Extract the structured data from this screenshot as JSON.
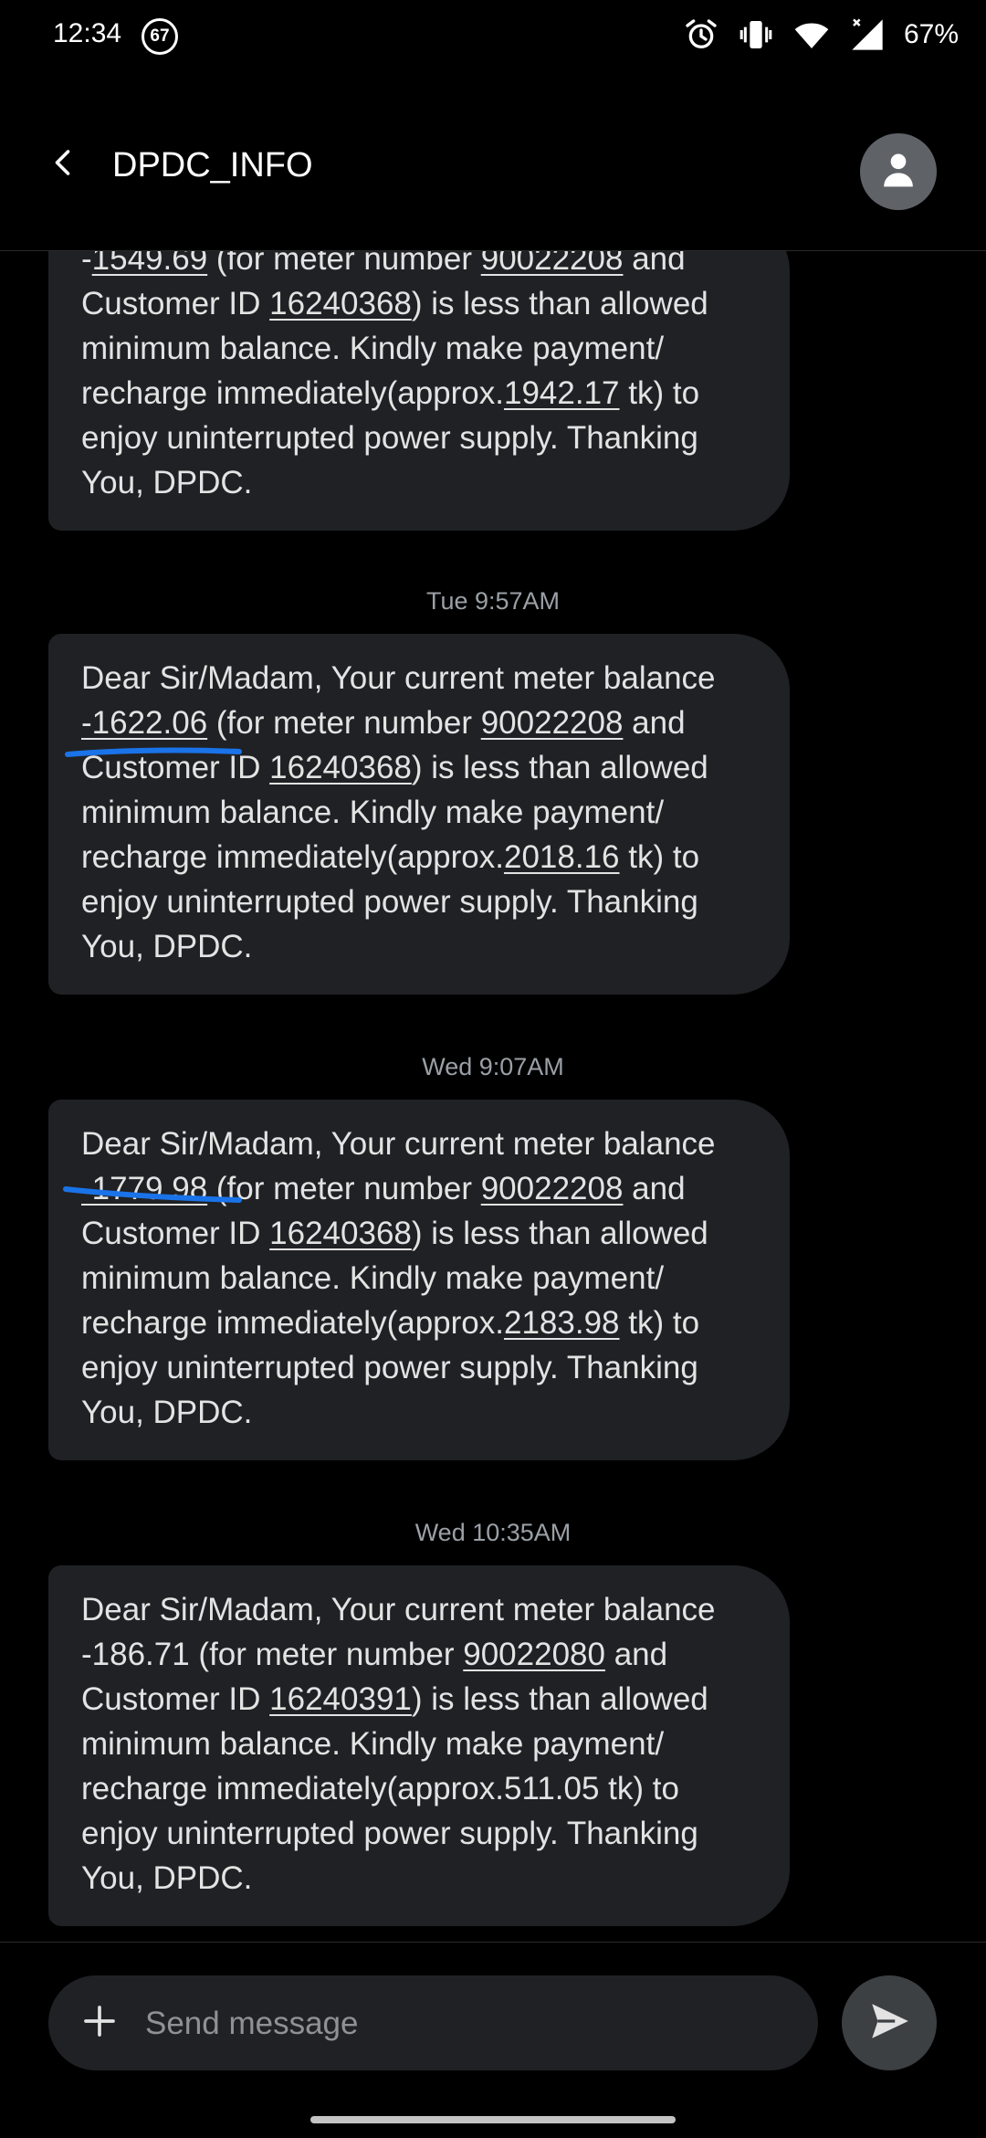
{
  "status_bar": {
    "time": "12:34",
    "notification_badge": "67",
    "battery": "67%",
    "icons": [
      "alarm-icon",
      "vibrate-icon",
      "wifi-icon",
      "signal-icon"
    ]
  },
  "header": {
    "title": "DPDC_INFO",
    "back_icon": "back-arrow-icon",
    "avatar_icon": "person-icon"
  },
  "messages": [
    {
      "timestamp": "",
      "segments": [
        {
          "t": "-"
        },
        {
          "t": "1549.69",
          "u": true
        },
        {
          "t": " (for meter number "
        },
        {
          "t": "90022208",
          "u": true
        },
        {
          "t": " and Customer ID "
        },
        {
          "t": "16240368",
          "u": true
        },
        {
          "t": ") is less than allowed minimum balance. Kindly make payment/ recharge immediately(approx."
        },
        {
          "t": "1942.17",
          "u": true
        },
        {
          "t": " tk) to enjoy uninterrupted power supply. Thanking You, DPDC."
        }
      ]
    },
    {
      "timestamp": "Tue 9:57AM",
      "segments": [
        {
          "t": "Dear Sir/Madam, Your current meter balance "
        },
        {
          "t": "-1622.06",
          "u": true
        },
        {
          "t": " (for meter number "
        },
        {
          "t": "90022208",
          "u": true
        },
        {
          "t": " and Customer ID "
        },
        {
          "t": "16240368",
          "u": true
        },
        {
          "t": ") is less than allowed minimum balance. Kindly make payment/ recharge immediately(approx."
        },
        {
          "t": "2018.16",
          "u": true
        },
        {
          "t": " tk) to enjoy uninterrupted power supply. Thanking You, DPDC."
        }
      ]
    },
    {
      "timestamp": "Wed 9:07AM",
      "segments": [
        {
          "t": "Dear Sir/Madam, Your current meter balance "
        },
        {
          "t": "-1779.98",
          "u": true
        },
        {
          "t": " (for meter number "
        },
        {
          "t": "90022208",
          "u": true
        },
        {
          "t": " and Customer ID "
        },
        {
          "t": "16240368",
          "u": true
        },
        {
          "t": ") is less than allowed minimum balance. Kindly make payment/ recharge immediately(approx."
        },
        {
          "t": "2183.98",
          "u": true
        },
        {
          "t": " tk) to enjoy uninterrupted power supply. Thanking You, DPDC."
        }
      ]
    },
    {
      "timestamp": "Wed 10:35AM",
      "segments": [
        {
          "t": "Dear Sir/Madam, Your current meter balance -186.71 (for meter number "
        },
        {
          "t": "90022080",
          "u": true
        },
        {
          "t": " and Customer ID "
        },
        {
          "t": "16240391",
          "u": true
        },
        {
          "t": ") is less than allowed minimum balance. Kindly make payment/ recharge immediately(approx.511.05 tk) to enjoy uninterrupted power supply. Thanking You, DPDC."
        }
      ]
    }
  ],
  "composer": {
    "placeholder": "Send message",
    "attach_icon": "plus-icon",
    "send_icon": "send-icon"
  },
  "colors": {
    "background": "#000000",
    "bubble": "#202124",
    "annotation_ink": "#1a73e8"
  }
}
